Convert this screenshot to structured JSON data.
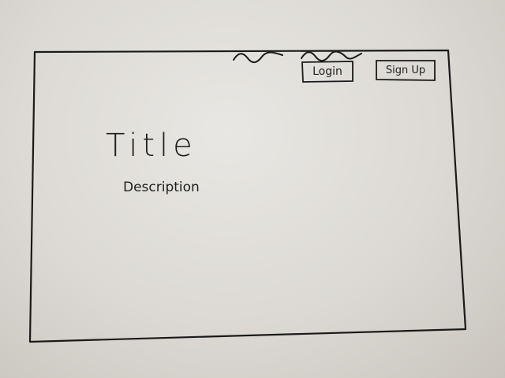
{
  "header": {
    "login_label": "Login",
    "signup_label": "Sign Up"
  },
  "hero": {
    "title": "Title",
    "description": "Description"
  }
}
